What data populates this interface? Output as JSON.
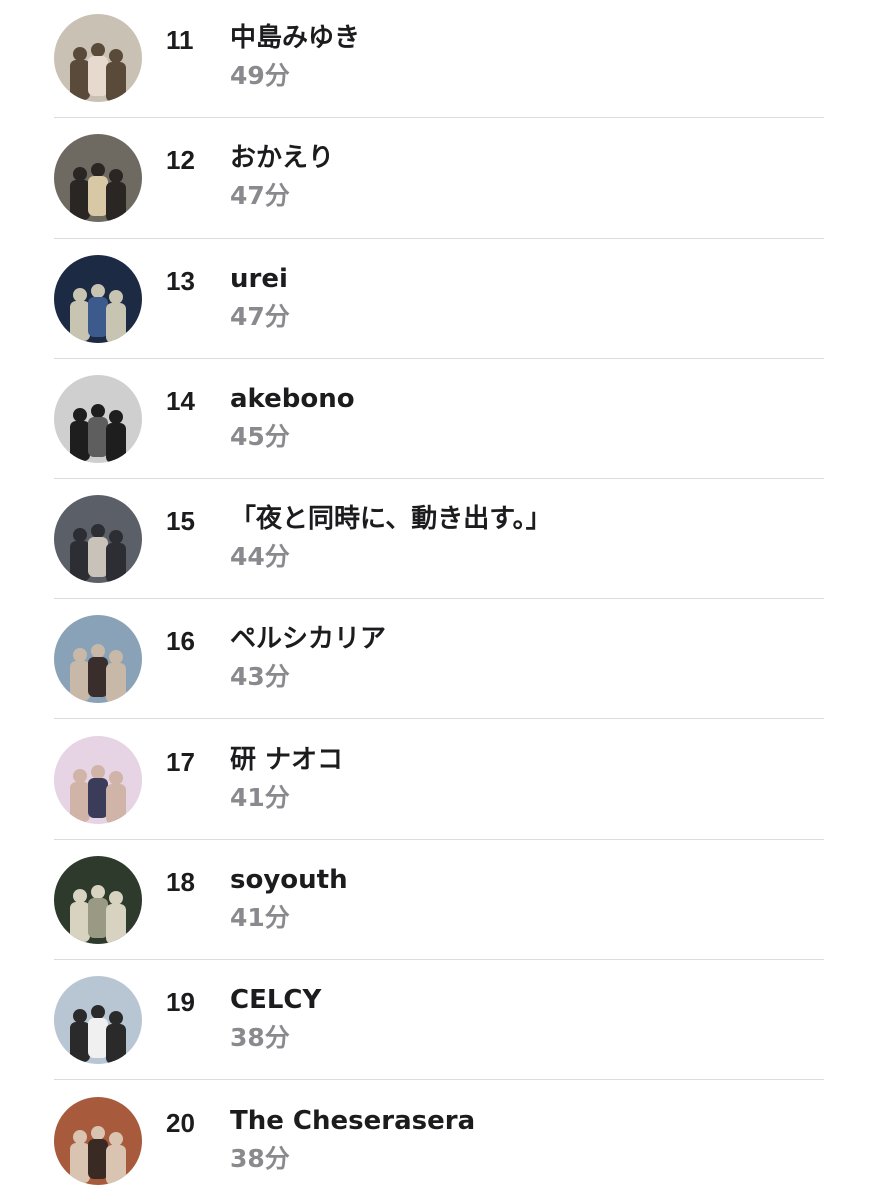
{
  "ranking": {
    "items": [
      {
        "rank": "11",
        "name": "中島みゆき",
        "time": "49分",
        "avatar": {
          "bg": "#c9c2b4",
          "fg": "#e8d9cf",
          "accent": "#5a4a3a"
        }
      },
      {
        "rank": "12",
        "name": "おかえり",
        "time": "47分",
        "avatar": {
          "bg": "#6e6a62",
          "fg": "#d8c8a6",
          "accent": "#2a2624"
        }
      },
      {
        "rank": "13",
        "name": "urei",
        "time": "47分",
        "avatar": {
          "bg": "#1d2a44",
          "fg": "#3c5a8c",
          "accent": "#c8c4b2"
        }
      },
      {
        "rank": "14",
        "name": "akebono",
        "time": "45分",
        "avatar": {
          "bg": "#cfcfcf",
          "fg": "#5e5e5e",
          "accent": "#1e1e1e"
        }
      },
      {
        "rank": "15",
        "name": "「夜と同時に、動き出す。」",
        "time": "44分",
        "avatar": {
          "bg": "#5b6068",
          "fg": "#c8c2b8",
          "accent": "#2c2e34"
        }
      },
      {
        "rank": "16",
        "name": "ペルシカリア",
        "time": "43分",
        "avatar": {
          "bg": "#8aa2b8",
          "fg": "#3a2e2c",
          "accent": "#c8b8a8"
        }
      },
      {
        "rank": "17",
        "name": "研 ナオコ",
        "time": "41分",
        "avatar": {
          "bg": "#e6d4e4",
          "fg": "#3a3c5a",
          "accent": "#d0b4a8"
        }
      },
      {
        "rank": "18",
        "name": "soyouth",
        "time": "41分",
        "avatar": {
          "bg": "#2e3a2c",
          "fg": "#9a9a84",
          "accent": "#d8d2c0"
        }
      },
      {
        "rank": "19",
        "name": "CELCY",
        "time": "38分",
        "avatar": {
          "bg": "#b8c6d4",
          "fg": "#f0f0f0",
          "accent": "#2a2a2a"
        }
      },
      {
        "rank": "20",
        "name": "The Cheserasera",
        "time": "38分",
        "avatar": {
          "bg": "#a85a3c",
          "fg": "#3a2a24",
          "accent": "#d8c4b0"
        }
      }
    ]
  }
}
